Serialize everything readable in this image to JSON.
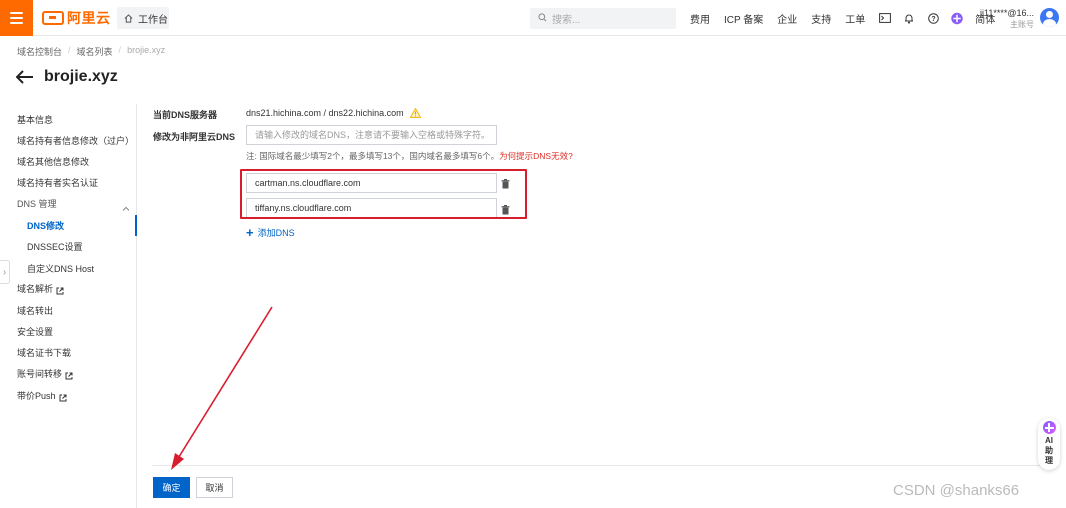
{
  "topbar": {
    "logo_text": "阿里云",
    "workbench_label": "工作台",
    "search_placeholder": "搜索...",
    "links": [
      "费用",
      "ICP 备案",
      "企业",
      "支持",
      "工单"
    ],
    "lang_label": "简体",
    "account_name": "jj11****@16...",
    "account_sub": "主账号"
  },
  "breadcrumb": {
    "items": [
      "域名控制台",
      "域名列表",
      "brojie.xyz"
    ]
  },
  "page": {
    "title": "brojie.xyz"
  },
  "sidebar": {
    "items": [
      {
        "label": "基本信息"
      },
      {
        "label": "域名持有者信息修改（过户）"
      },
      {
        "label": "域名其他信息修改"
      },
      {
        "label": "域名持有者实名认证"
      },
      {
        "label": "DNS 管理"
      },
      {
        "label": "DNS修改"
      },
      {
        "label": "DNSSEC设置"
      },
      {
        "label": "自定义DNS Host"
      },
      {
        "label": "域名解析"
      },
      {
        "label": "域名转出"
      },
      {
        "label": "安全设置"
      },
      {
        "label": "域名证书下载"
      },
      {
        "label": "账号间转移"
      },
      {
        "label": "带价Push"
      }
    ],
    "active_item": "DNS修改"
  },
  "form": {
    "current_dns_label": "当前DNS服务器",
    "current_dns_value": "dns21.hichina.com / dns22.hichina.com",
    "modify_label": "修改为非阿里云DNS",
    "modify_placeholder": "请输入修改的域名DNS，注意请不要输入空格或特殊字符。",
    "note_text": "注:  国际域名最少填写2个，最多填写13个，国内域名最多填写6个。",
    "note_link": "为何提示DNS无效?",
    "dns1_value": "cartman.ns.cloudflare.com",
    "dns2_value": "tiffany.ns.cloudflare.com",
    "add_dns_label": "添加DNS"
  },
  "actions": {
    "confirm_label": "确定",
    "cancel_label": "取消"
  },
  "ai_helper": {
    "label": "AI助理"
  },
  "watermark": "CSDN @shanks66",
  "colors": {
    "brand_orange": "#ff6a00",
    "primary_blue": "#0064c8",
    "annotation_red": "#d81e2c"
  }
}
